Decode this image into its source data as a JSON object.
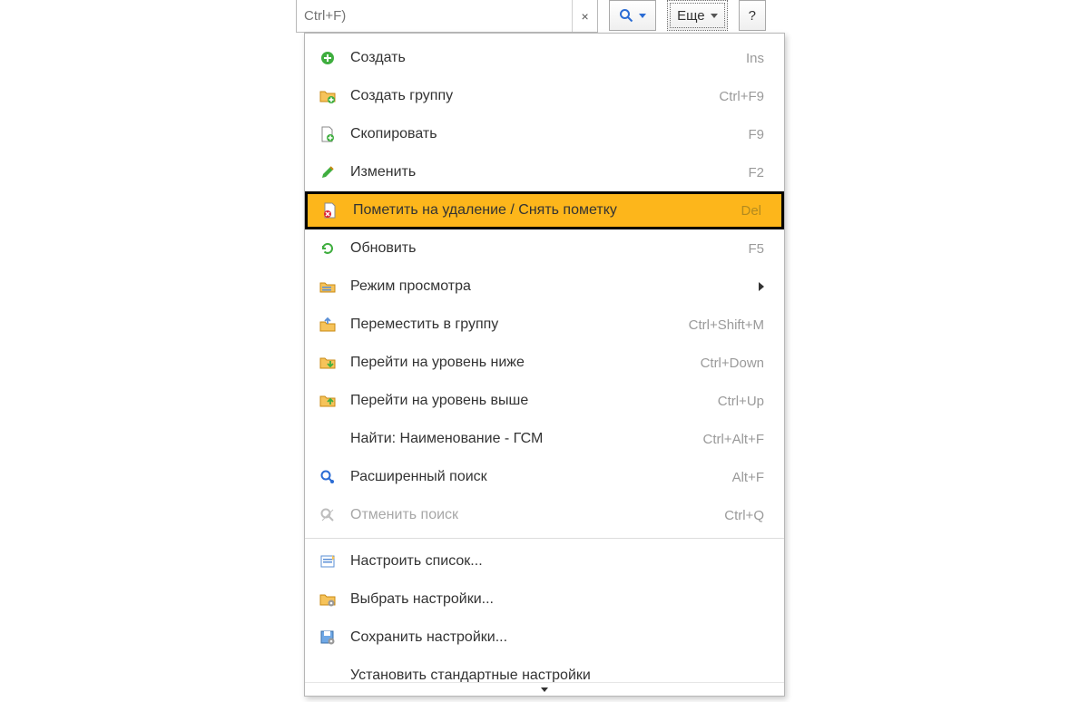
{
  "toolbar": {
    "search_placeholder": "Ctrl+F)",
    "more_label": "Еще",
    "help_label": "?"
  },
  "menu": {
    "items": [
      {
        "icon": "plus-circle-icon",
        "label": "Создать",
        "shortcut": "Ins"
      },
      {
        "icon": "folder-plus-icon",
        "label": "Создать группу",
        "shortcut": "Ctrl+F9"
      },
      {
        "icon": "file-plus-icon",
        "label": "Скопировать",
        "shortcut": "F9"
      },
      {
        "icon": "pencil-icon",
        "label": "Изменить",
        "shortcut": "F2"
      },
      {
        "icon": "file-delete-icon",
        "label": "Пометить на удаление / Снять пометку",
        "shortcut": "Del",
        "highlight": true
      },
      {
        "icon": "refresh-icon",
        "label": "Обновить",
        "shortcut": "F5"
      },
      {
        "icon": "view-mode-icon",
        "label": "Режим просмотра",
        "submenu": true
      },
      {
        "icon": "move-folder-icon",
        "label": "Переместить в группу",
        "shortcut": "Ctrl+Shift+M"
      },
      {
        "icon": "folder-down-icon",
        "label": "Перейти на уровень ниже",
        "shortcut": "Ctrl+Down"
      },
      {
        "icon": "folder-up-icon",
        "label": "Перейти на уровень выше",
        "shortcut": "Ctrl+Up"
      },
      {
        "icon": "none",
        "label": "Найти: Наименование - ГСМ",
        "shortcut": "Ctrl+Alt+F"
      },
      {
        "icon": "search-adv-icon",
        "label": "Расширенный поиск",
        "shortcut": "Alt+F"
      },
      {
        "icon": "search-cancel-icon",
        "label": "Отменить поиск",
        "shortcut": "Ctrl+Q",
        "disabled": true
      },
      {
        "separator": true
      },
      {
        "icon": "list-config-icon",
        "label": "Настроить список..."
      },
      {
        "icon": "folder-gear-icon",
        "label": "Выбрать настройки..."
      },
      {
        "icon": "save-gear-icon",
        "label": "Сохранить настройки..."
      },
      {
        "icon": "none",
        "label": "Установить стандартные настройки"
      }
    ]
  }
}
